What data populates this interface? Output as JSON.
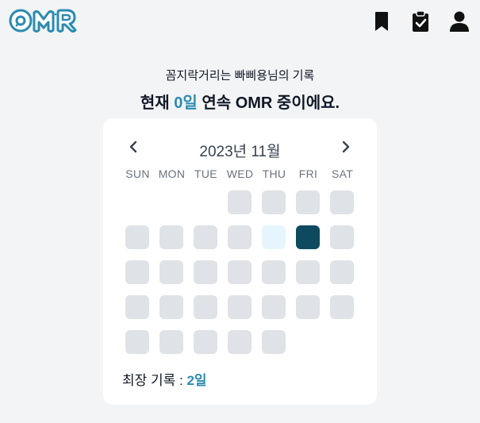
{
  "app": {
    "logo_text": "OMR"
  },
  "header_icons": [
    "bookmark-icon",
    "clipboard-check-icon",
    "user-icon"
  ],
  "profile": {
    "subtitle": "꼼지락거리는 빠삐용님의 기록",
    "headline_prefix": "현재 ",
    "streak_current": "0일",
    "headline_suffix": " 연속 OMR 중이에요."
  },
  "calendar": {
    "month_label": "2023년 11월",
    "prev_icon": "chevron-left-icon",
    "next_icon": "chevron-right-icon",
    "weekdays": [
      "SUN",
      "MON",
      "TUE",
      "WED",
      "THU",
      "FRI",
      "SAT"
    ],
    "first_weekday_index": 3,
    "days_in_month": 30,
    "today_day": 9,
    "active_days": [
      10
    ],
    "record_label": "최장 기록 : ",
    "record_value": "2일"
  },
  "colors": {
    "accent": "#2b8bb0",
    "active_day": "#0d4a60",
    "today_day": "#e6f5fd",
    "empty_day": "#dfe2e6"
  }
}
